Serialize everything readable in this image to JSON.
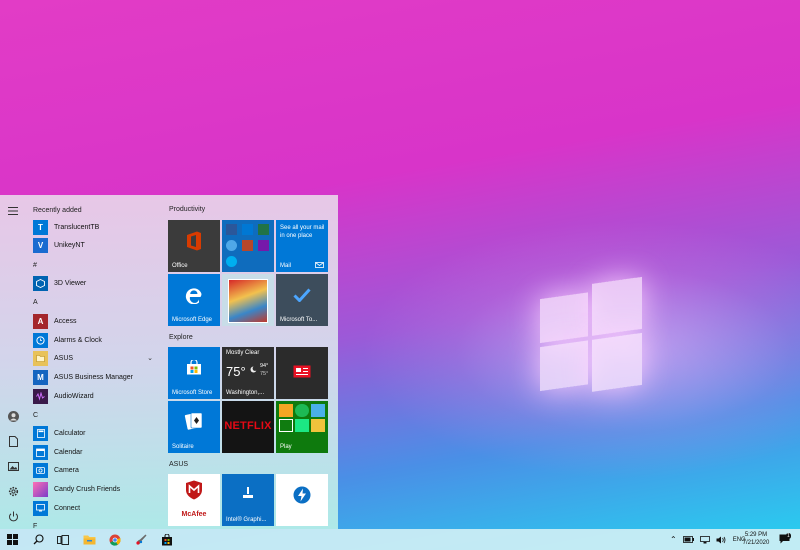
{
  "start_menu": {
    "apps": {
      "recently_added_header": "Recently added",
      "translucenttb": "TranslucentTB",
      "unikeynt": "UnikeyNT",
      "hash_header": "#",
      "viewer3d": "3D Viewer",
      "a_header": "A",
      "access": "Access",
      "alarms": "Alarms & Clock",
      "asus": "ASUS",
      "asus_bm": "ASUS Business Manager",
      "audiowizard": "AudioWizard",
      "c_header": "C",
      "calculator": "Calculator",
      "calendar": "Calendar",
      "camera": "Camera",
      "candy": "Candy Crush Friends",
      "connect": "Connect",
      "f_header": "F"
    },
    "groups": {
      "productivity": "Productivity",
      "explore": "Explore",
      "asus": "ASUS"
    },
    "tiles": {
      "office": "Office",
      "mail_promo": "See all your mail in one place",
      "mail": "Mail",
      "edge": "Microsoft Edge",
      "todo": "Microsoft To...",
      "store": "Microsoft Store",
      "weather_condition": "Mostly Clear",
      "weather_temp": "75°",
      "weather_high": "94°",
      "weather_low": "75°",
      "weather_city": "Washington,...",
      "netflix": "NETFLIX",
      "solitaire": "Solitaire",
      "play": "Play",
      "mcafee": "McAfee",
      "intel": "Intel® Graphi..."
    }
  },
  "taskbar": {
    "language": "ENG",
    "time": "5:29 PM",
    "date": "7/21/2020",
    "notification_count": "1"
  },
  "colors": {
    "accent": "#0078d7",
    "office": "#3b3b3b",
    "weather": "#2e2e2e",
    "netflix_bg": "#141414",
    "netflix_text": "#e50914"
  }
}
